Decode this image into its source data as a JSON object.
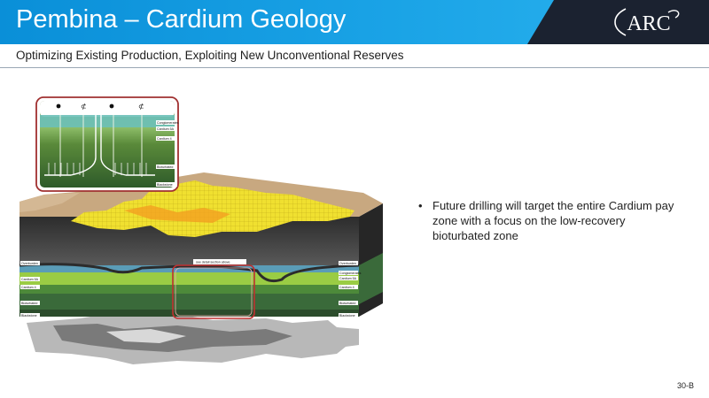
{
  "header": {
    "title": "Pembina – Cardium Geology",
    "logo_text": "ARC",
    "colors": {
      "bar": "#1aa3e6",
      "dark": "#1b2230"
    }
  },
  "subtitle": "Optimizing Existing Production, Exploiting New Unconventional Reserves",
  "figure": {
    "inset_labels": [
      "Conglomerates",
      "Cardium 5A",
      "Cardium 4",
      "Bioturbated",
      "Blackstone"
    ],
    "block_labels_left": [
      "Overburden",
      "Cardium 5A",
      "Cardium 4",
      "Bioturbated",
      "Blackstone"
    ],
    "block_labels_right": [
      "Overburden",
      "Conglomerates",
      "Cardium 5A",
      "Cardium 4",
      "Bioturbated",
      "Blackstone"
    ],
    "callout_label": "see detail section above",
    "icons": [
      "oil-well-symbol-icon",
      "injector-well-symbol-icon"
    ]
  },
  "bullets": [
    "Future drilling will target the entire Cardium pay zone with a focus on the low-recovery bioturbated zone"
  ],
  "page_number": "30-B"
}
